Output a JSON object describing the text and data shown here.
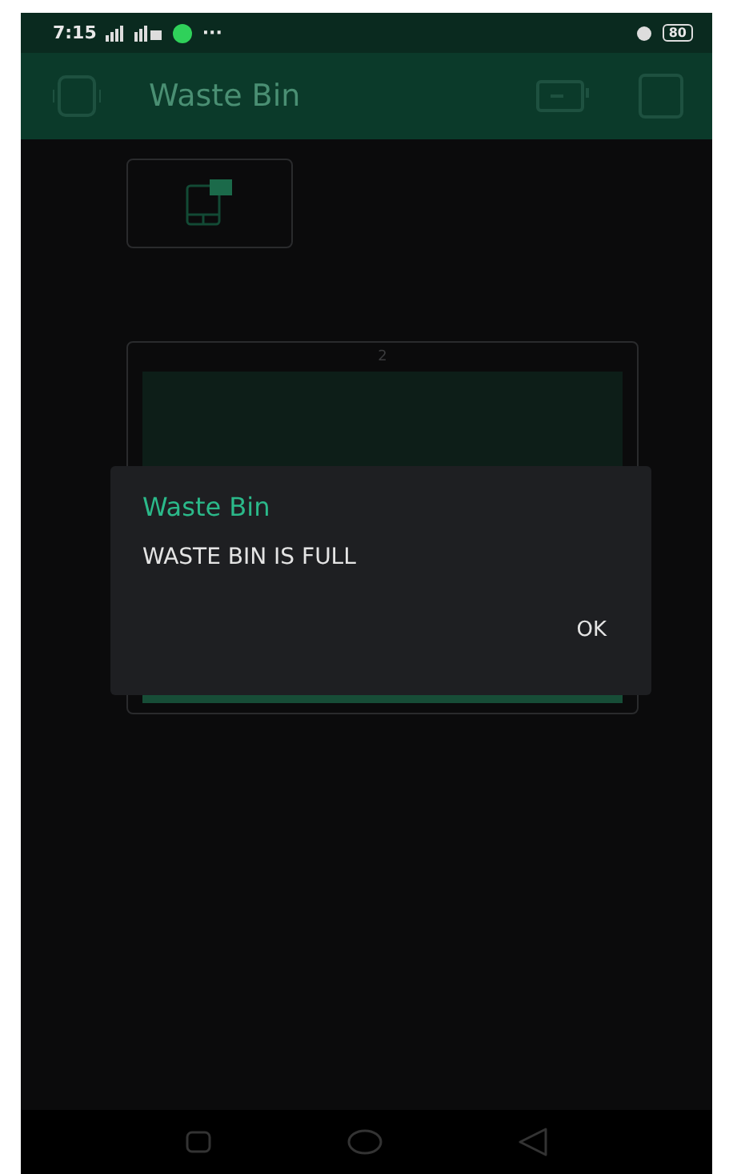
{
  "status_bar": {
    "time": "7:15",
    "more": "···",
    "battery": "80"
  },
  "app_bar": {
    "title": "Waste Bin"
  },
  "level_widget": {
    "label": "2"
  },
  "dialog": {
    "title": "Waste Bin",
    "message": "WASTE BIN IS FULL",
    "buttons": [
      "OK"
    ]
  }
}
